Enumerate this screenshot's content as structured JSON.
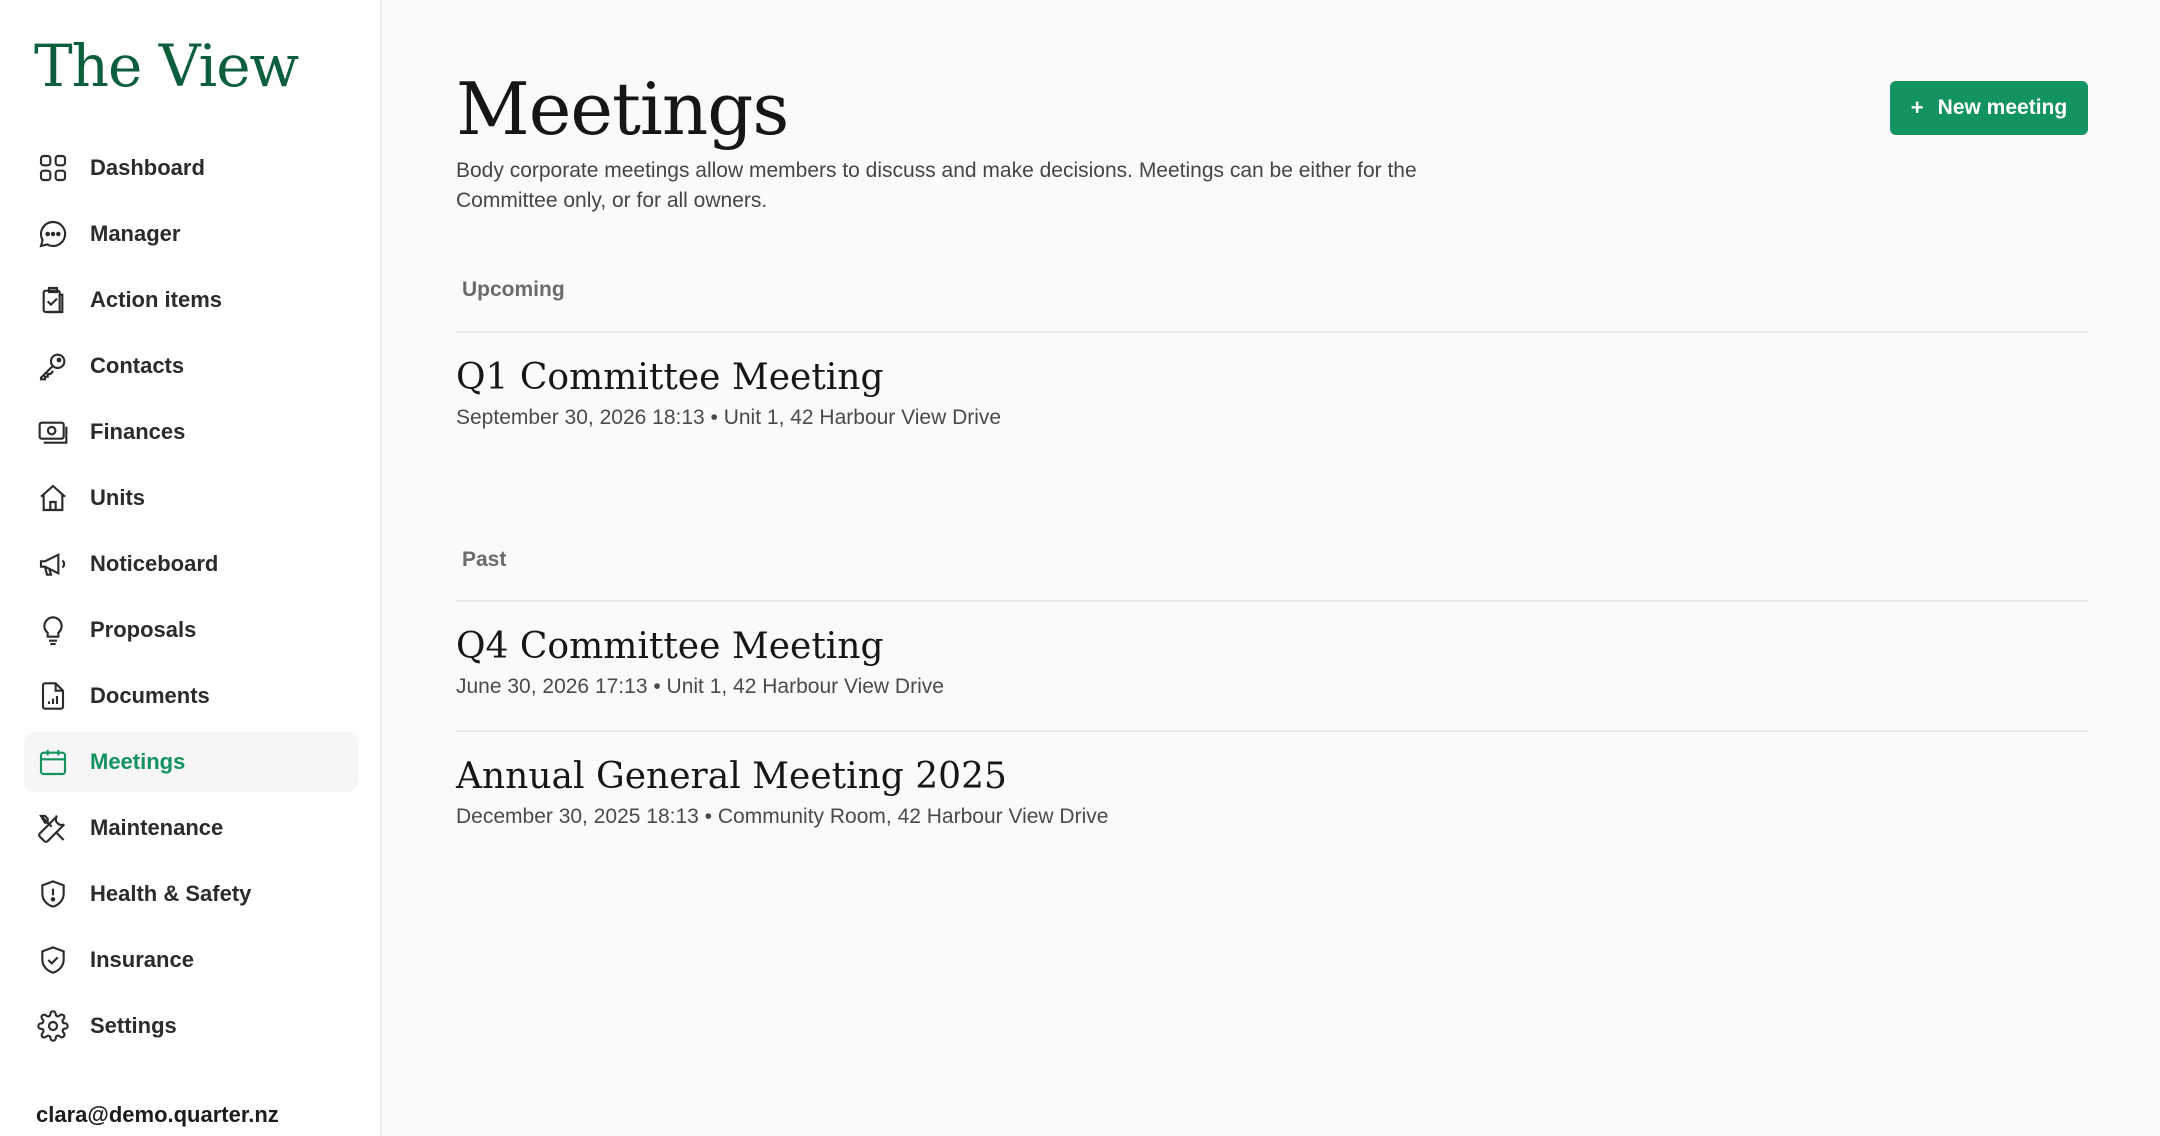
{
  "brand": {
    "name": "The View",
    "color": "#0d5e3c"
  },
  "sidebar": {
    "items": [
      {
        "label": "Dashboard",
        "icon": "grid-icon",
        "active": false
      },
      {
        "label": "Manager",
        "icon": "chat-bubble-icon",
        "active": false
      },
      {
        "label": "Action items",
        "icon": "clipboard-check-icon",
        "active": false
      },
      {
        "label": "Contacts",
        "icon": "key-icon",
        "active": false
      },
      {
        "label": "Finances",
        "icon": "banknote-icon",
        "active": false
      },
      {
        "label": "Units",
        "icon": "home-icon",
        "active": false
      },
      {
        "label": "Noticeboard",
        "icon": "megaphone-icon",
        "active": false
      },
      {
        "label": "Proposals",
        "icon": "lightbulb-icon",
        "active": false
      },
      {
        "label": "Documents",
        "icon": "document-chart-icon",
        "active": false
      },
      {
        "label": "Meetings",
        "icon": "calendar-icon",
        "active": true
      },
      {
        "label": "Maintenance",
        "icon": "tools-icon",
        "active": false
      },
      {
        "label": "Health & Safety",
        "icon": "shield-alert-icon",
        "active": false
      },
      {
        "label": "Insurance",
        "icon": "shield-check-icon",
        "active": false
      },
      {
        "label": "Settings",
        "icon": "gear-icon",
        "active": false
      }
    ],
    "user_email": "clara@demo.quarter.nz"
  },
  "main": {
    "title": "Meetings",
    "description": "Body corporate meetings allow members to discuss and make decisions. Meetings can be either for the Committee only, or for all owners.",
    "new_button": {
      "icon": "plus-icon",
      "plus": "+",
      "label": "New meeting"
    },
    "upcoming": {
      "label": "Upcoming",
      "meetings": [
        {
          "title": "Q1 Committee Meeting",
          "meta": "September 30, 2026 18:13 • Unit 1, 42 Harbour View Drive"
        }
      ]
    },
    "past": {
      "label": "Past",
      "meetings": [
        {
          "title": "Q4 Committee Meeting",
          "meta": "June 30, 2026 17:13 • Unit 1, 42 Harbour View Drive"
        },
        {
          "title": "Annual General Meeting 2025",
          "meta": "December 30, 2025 18:13 • Community Room, 42 Harbour View Drive"
        }
      ]
    }
  },
  "colors": {
    "accent": "#13935f",
    "active_bg": "#f5f6f5"
  }
}
